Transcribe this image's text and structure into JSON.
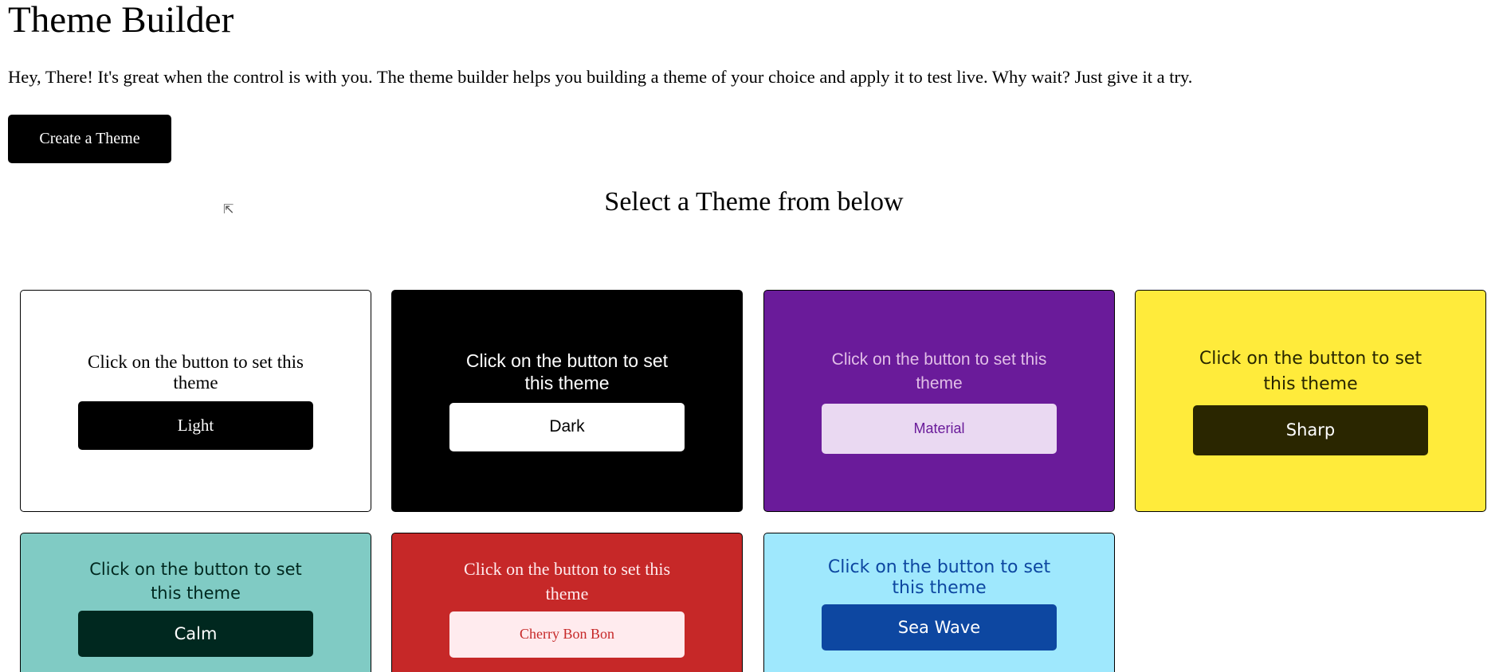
{
  "header": {
    "title": "Theme Builder",
    "intro": "Hey, There! It's great when the control is with you. The theme builder helps you building a theme of your choice and apply it to test live. Why wait? Just give it a try.",
    "create_button": "Create a Theme"
  },
  "section_title": "Select a Theme from below",
  "themes": [
    {
      "message": "Click on the button to set this theme",
      "button": "Light",
      "bg": "#ffffff"
    },
    {
      "message": "Click on the button to set this theme",
      "button": "Dark",
      "bg": "#000000"
    },
    {
      "message": "Click on the button to set this theme",
      "button": "Material",
      "bg": "#6a1b9a"
    },
    {
      "message": "Click on the button to set this theme",
      "button": "Sharp",
      "bg": "#ffeb3b"
    },
    {
      "message": "Click on the button to set this theme",
      "button": "Calm",
      "bg": "#80cbc4"
    },
    {
      "message": "Click on the button to set this theme",
      "button": "Cherry Bon Bon",
      "bg": "#c62828"
    },
    {
      "message": "Click on the button to set this theme",
      "button": "Sea Wave",
      "bg": "#9fe8fd"
    }
  ]
}
